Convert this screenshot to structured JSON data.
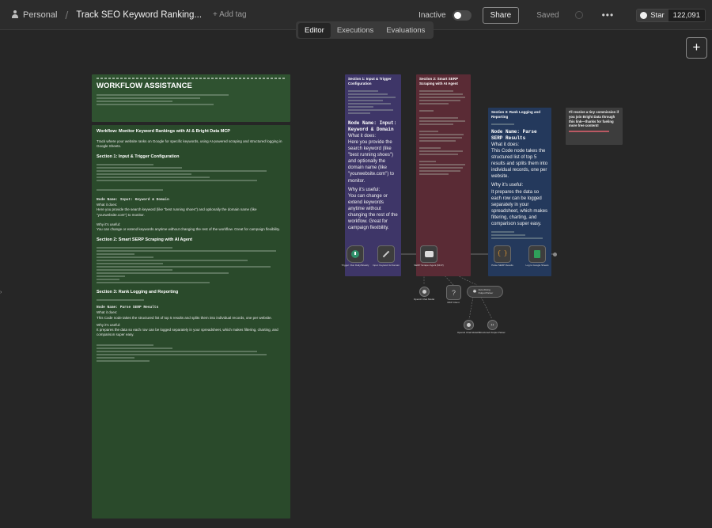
{
  "topbar": {
    "project": "Personal",
    "separator": "/",
    "workflow_title": "Track SEO Keyword Ranking...",
    "add_tag": "+ Add tag",
    "status_label": "Inactive",
    "share_label": "Share",
    "saved_label": "Saved",
    "more_label": "•••",
    "github_star_label": "Star",
    "github_star_count": "122,091"
  },
  "tabs": [
    "Editor",
    "Executions",
    "Evaluations"
  ],
  "canvas": {
    "add_node_label": "+",
    "sticky_main_header": {
      "title": "WORKFLOW ASSISTANCE"
    },
    "sticky_main": {
      "title": "Workflow: Monitor Keyword Rankings with AI & Bright Data MCP",
      "intro": "Track where your website ranks on Google for specific keywords, using AI-powered scraping and structured logging in Google Sheets.",
      "s1_title": "Section 1: Input & Trigger Configuration",
      "s1_node": "Node Name: Input: Keyword & Domain",
      "s1_what": "What it does:",
      "s1_desc": "Here you provide the search keyword (like \"best running shoes\") and optionally the domain name (like \"yourwebsite.com\") to monitor.",
      "s1_why": "Why it's useful:",
      "s1_why_desc": "You can change or extend keywords anytime without changing the rest of the workflow. Great for campaign flexibility.",
      "s2_title": "Section 2: Smart SERP Scraping with AI Agent",
      "s3_title": "Section 3: Rank Logging and Reporting",
      "s3_node": "Node Name: Parse SERP Results",
      "s3_what": "What it does:",
      "s3_desc": "This Code node takes the structured list of top 5 results and splits them into individual records, one per website.",
      "s3_why": "Why it's useful:",
      "s3_why_desc": "It prepares the data so each row can be logged separately in your spreadsheet, which makes filtering, charting, and comparison super easy."
    },
    "sticky_section1": {
      "title": "Section 1: Input & Trigger Configuration",
      "node": "Node Name: Input: Keyword & Domain",
      "what": "What it does:",
      "desc": "Here you provide the search keyword (like \"best running shoes\") and optionally the domain name (like \"yourwebsite.com\") to monitor.",
      "why": "Why it's useful:",
      "why_desc": "You can change or extend keywords anytime without changing the rest of the workflow. Great for campaign flexibility."
    },
    "sticky_section2": {
      "title": "Section 2: Smart SERP Scraping with AI Agent"
    },
    "sticky_section3": {
      "title": "Section 3: Rank Logging and Reporting",
      "node": "Node Name: Parse SERP Results",
      "what": "What it does:",
      "desc": "This Code node takes the structured list of top 5 results and splits them into individual records, one per website.",
      "why": "Why it's useful:",
      "why_desc": "It prepares the data so each row can be logged separately in your spreadsheet, which makes filtering, charting, and comparison super easy."
    },
    "sticky_affiliate": {
      "text": "I'll receive a tiny commission if you join Bright Data through this link—thanks for fueling more free content!"
    },
    "nodes": [
      {
        "label": "Trigger: Run Daily/Weekly",
        "icon": "clock-icon"
      },
      {
        "label": "Input: Keyword & Domain",
        "icon": "pen-icon"
      },
      {
        "label": "SERP Scraper Agent (MCP)",
        "icon": "robot-icon"
      },
      {
        "label": "Parse SERP Results",
        "icon": "code-icon"
      },
      {
        "label": "Log to Google Sheets",
        "icon": "sheets-icon"
      }
    ],
    "sub_nodes": [
      {
        "label": "OpenAI Chat Model",
        "icon": "openai-icon"
      },
      {
        "label": "MCP Client",
        "icon": "question-icon"
      },
      {
        "label": "Auto-Fixing Output Parser",
        "icon": "wrench-icon"
      },
      {
        "label": "OpenAI Chat Model1",
        "icon": "openai-icon"
      },
      {
        "label": "Structured Output Parser",
        "icon": "braces-icon"
      }
    ]
  },
  "colors": {
    "canvas_bg": "#262626",
    "sticky_green": "#2a4a2b",
    "sticky_purple": "#3e3668",
    "sticky_red": "#5a2b35",
    "sticky_blue": "#24395c",
    "sticky_gray": "#3d3d3d"
  }
}
